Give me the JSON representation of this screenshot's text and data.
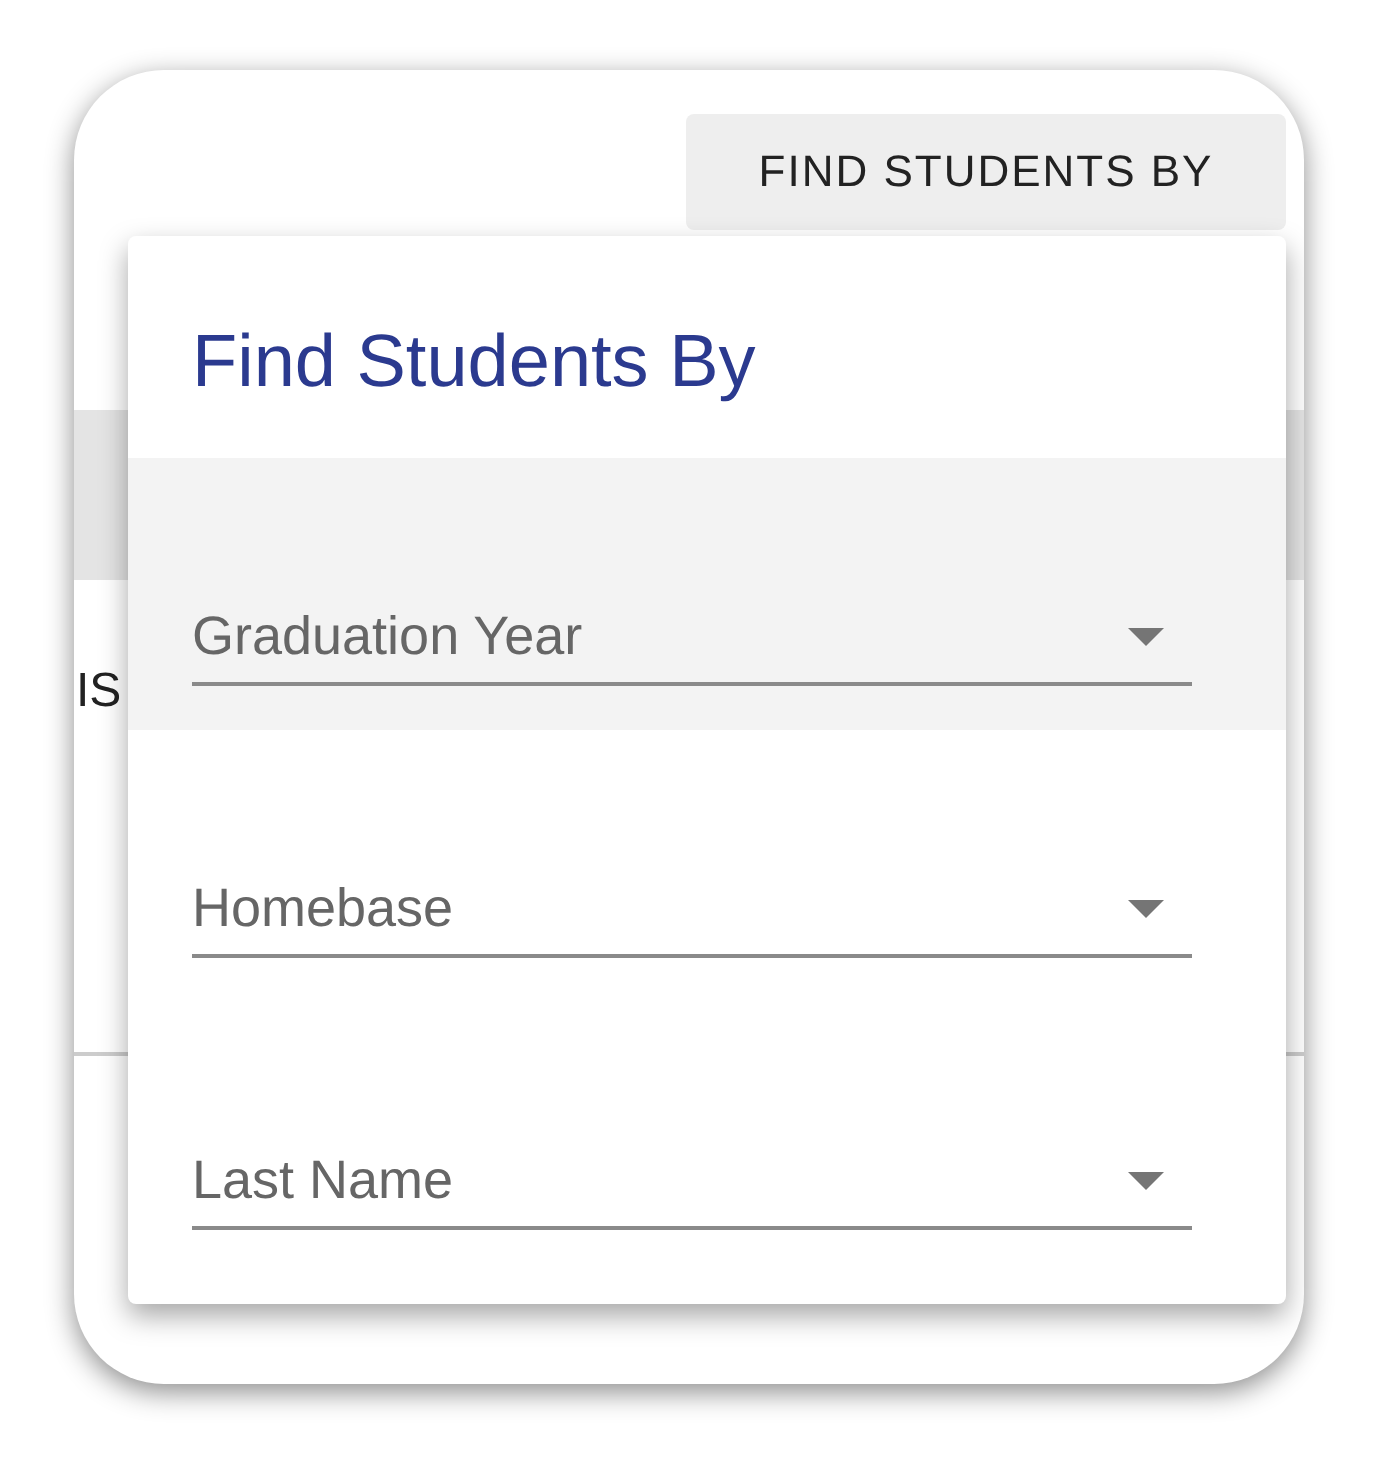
{
  "toolbar": {
    "button": "FIND STUDENTS BY"
  },
  "background": {
    "text": "IS"
  },
  "menu": {
    "title": "Find Students By",
    "items": [
      {
        "label": "Graduation Year",
        "selected": true
      },
      {
        "label": "Homebase",
        "selected": false
      },
      {
        "label": "Last Name",
        "selected": false
      }
    ]
  }
}
